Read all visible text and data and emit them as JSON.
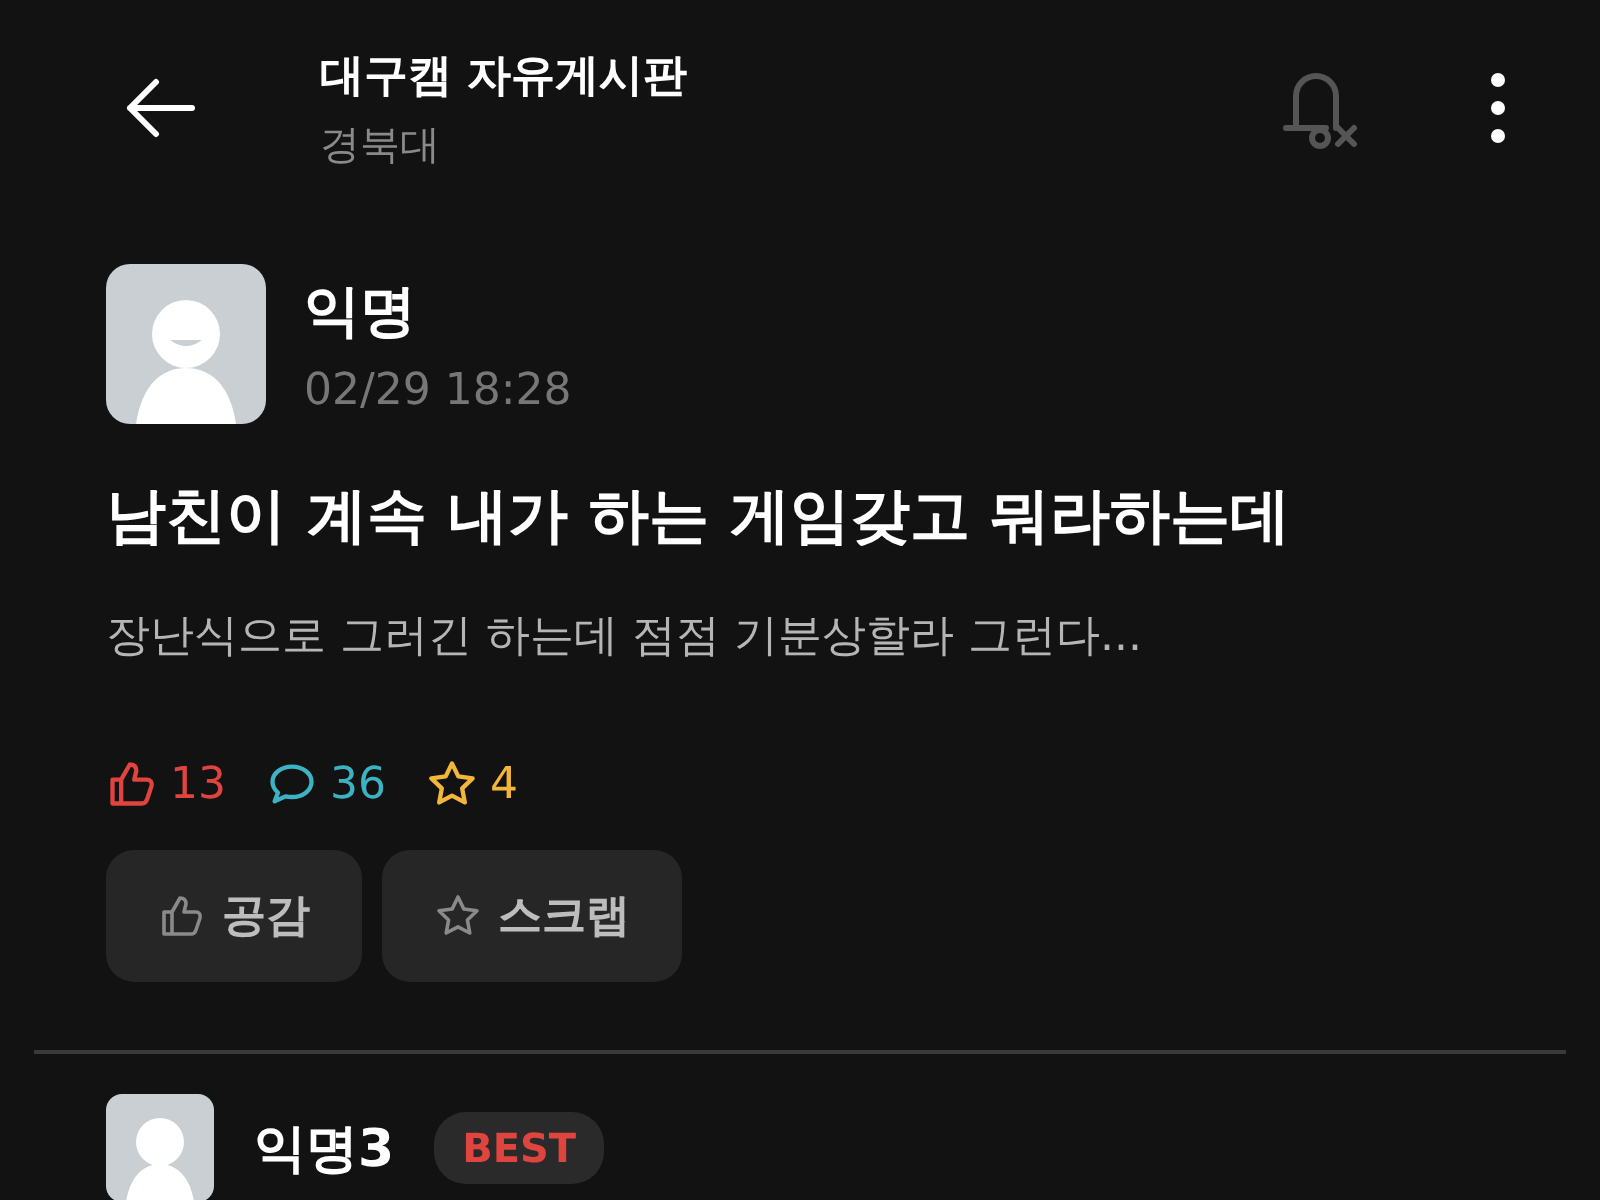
{
  "header": {
    "title": "대구캠 자유게시판",
    "subtitle": "경북대"
  },
  "post": {
    "author": "익명",
    "time": "02/29 18:28",
    "title": "남친이 계속 내가 하는 게임갖고 뭐라하는데",
    "body": "장난식으로 그러긴 하는데 점점 기분상할라 그런다...",
    "stats": [
      {
        "kind": "like",
        "count": "13",
        "color": "#e0443e"
      },
      {
        "kind": "comment",
        "count": "36",
        "color": "#3bb3c3"
      },
      {
        "kind": "scrap",
        "count": "4",
        "color": "#f2b63a"
      }
    ],
    "buttons": [
      {
        "kind": "like",
        "label": "공감"
      },
      {
        "kind": "scrap",
        "label": "스크랩"
      }
    ]
  },
  "comments": [
    {
      "author": "익명3",
      "badge": "BEST"
    }
  ]
}
